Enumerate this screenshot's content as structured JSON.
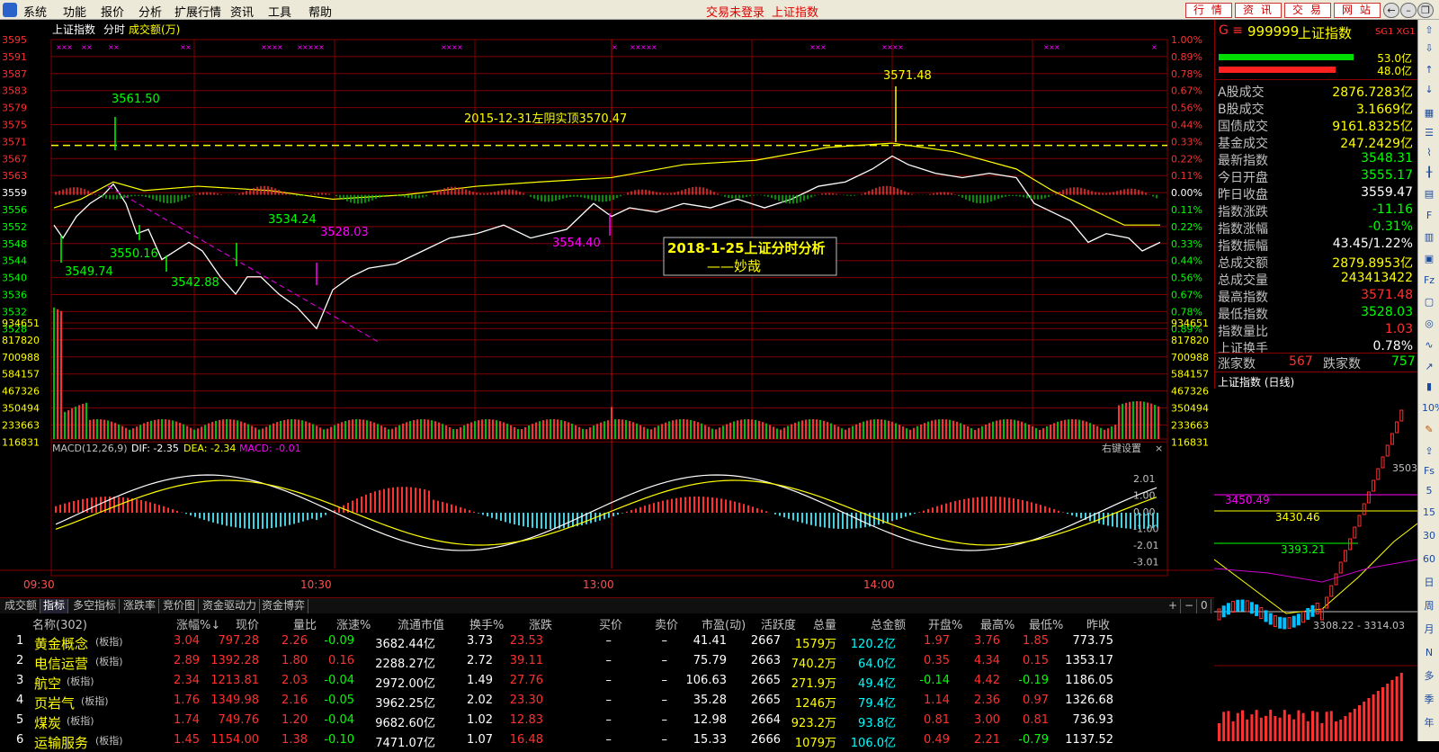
{
  "menu": {
    "items": [
      "系统",
      "功能",
      "报价",
      "分析",
      "扩展行情",
      "资讯",
      "工具",
      "帮助"
    ],
    "status": "交易未登录",
    "index_name": "上证指数",
    "quick_buttons": [
      "行 情",
      "资 讯",
      "交 易",
      "网 站"
    ]
  },
  "chart_header": {
    "name": "上证指数",
    "mode": "分时",
    "vol_label": "成交额(万)"
  },
  "price_axis": {
    "left": [
      "3595",
      "3591",
      "3587",
      "3583",
      "3579",
      "3575",
      "3571",
      "3567",
      "3563",
      "3559",
      "3556",
      "3552",
      "3548",
      "3544",
      "3540",
      "3536",
      "3532",
      "3528"
    ],
    "right": [
      "1.00%",
      "0.89%",
      "0.78%",
      "0.67%",
      "0.56%",
      "0.44%",
      "0.33%",
      "0.22%",
      "0.11%",
      "0.00%",
      "0.11%",
      "0.22%",
      "0.33%",
      "0.44%",
      "0.56%",
      "0.67%",
      "0.78%",
      "0.89%"
    ]
  },
  "volume_axis": [
    "934651",
    "817820",
    "700988",
    "584157",
    "467326",
    "350494",
    "233663",
    "116831"
  ],
  "macd": {
    "title": "MACD(12,26,9)",
    "dif": "DIF: -2.35",
    "dea": "DEA: -2.34",
    "macd": "MACD: -0.01",
    "right_label": "右键设置",
    "axis": [
      "2.01",
      "1.00",
      "0.00",
      "-1.00",
      "-2.01",
      "-3.01"
    ]
  },
  "time_axis": [
    "09:30",
    "10:30",
    "13:00",
    "14:00"
  ],
  "annotations": {
    "p3561": "3561.50",
    "p3549": "3549.74",
    "p3550": "3550.16",
    "p3542": "3542.88",
    "p3534": "3534.24",
    "p3528": "3528.03",
    "p3554": "3554.40",
    "p3571": "3571.48",
    "resist": "2015-12-31左阴实顶3570.47",
    "title1": "2018-1-25上证分时分析",
    "title2": "——妙哉"
  },
  "right_panel": {
    "code_prefix": "G ≡",
    "code": "999999",
    "name": "上证指数",
    "sg": "SG1 XG1",
    "bar1_value": "53.0亿",
    "bar2_value": "48.0亿",
    "rows": [
      {
        "label": "A股成交",
        "value": "2876.7283亿",
        "color": "#ffff00"
      },
      {
        "label": "B股成交",
        "value": "3.1669亿",
        "color": "#ffff00"
      },
      {
        "label": "国债成交",
        "value": "9161.8325亿",
        "color": "#ffff00"
      },
      {
        "label": "基金成交",
        "value": "247.2429亿",
        "color": "#ffff00"
      },
      {
        "label": "最新指数",
        "value": "3548.31",
        "color": "#00ff00"
      },
      {
        "label": "今日开盘",
        "value": "3555.17",
        "color": "#00ff00"
      },
      {
        "label": "昨日收盘",
        "value": "3559.47",
        "color": "#ffffff"
      },
      {
        "label": "指数涨跌",
        "value": "-11.16",
        "color": "#00ff00"
      },
      {
        "label": "指数涨幅",
        "value": "-0.31%",
        "color": "#00ff00"
      },
      {
        "label": "指数振幅",
        "value": "43.45/1.22%",
        "color": "#ffffff"
      },
      {
        "label": "总成交额",
        "value": "2879.8953亿",
        "color": "#ffff00"
      },
      {
        "label": "总成交量",
        "value": "243413422",
        "color": "#ffff00"
      },
      {
        "label": "最高指数",
        "value": "3571.48",
        "color": "#ff3030"
      },
      {
        "label": "最低指数",
        "value": "3528.03",
        "color": "#00ff00"
      },
      {
        "label": "指数量比",
        "value": "1.03",
        "color": "#ff3030"
      },
      {
        "label": "上证换手",
        "value": "0.78%",
        "color": "#ffffff"
      }
    ],
    "up_label": "涨家数",
    "up_value": "567",
    "down_label": "跌家数",
    "down_value": "757",
    "mini_title": "上证指数 (日线)",
    "mini_labels": [
      "3503.",
      "3450.49",
      "3430.46",
      "3393.21",
      "3308.22 - 3314.03"
    ]
  },
  "toolbar_right": [
    "10%",
    "5",
    "15",
    "30",
    "60",
    "日",
    "周",
    "月",
    "N",
    "多",
    "季",
    "年"
  ],
  "tabs": [
    "成交额",
    "指标",
    "多空指标",
    "涨跌率",
    "竞价图",
    "资金驱动力",
    "资金博弈"
  ],
  "tab_controls": [
    "+",
    "−",
    "0"
  ],
  "table": {
    "headers": [
      "名称(302)",
      "涨幅%↓",
      "现价",
      "量比",
      "涨速%",
      "流通市值",
      "换手%",
      "涨跌",
      "买价",
      "卖价",
      "市盈(动)",
      "活跃度",
      "总量",
      "总金额",
      "开盘%",
      "最高%",
      "最低%",
      "昨收"
    ],
    "rows": [
      {
        "idx": "1",
        "name": "黄金概念",
        "tag": "(板指)",
        "chg": "3.04",
        "price": "797.28",
        "vr": "2.26",
        "speed": "-0.09",
        "mcap": "3682.44亿",
        "turn": "3.73",
        "diff": "23.53",
        "bid": "–",
        "ask": "–",
        "pe": "41.41",
        "act": "2667",
        "vol": "1579万",
        "amt": "120.2亿",
        "open": "1.97",
        "high": "3.76",
        "low": "1.85",
        "prev": "773.75"
      },
      {
        "idx": "2",
        "name": "电信运营",
        "tag": "(板指)",
        "chg": "2.89",
        "price": "1392.28",
        "vr": "1.80",
        "speed": "0.16",
        "mcap": "2288.27亿",
        "turn": "2.72",
        "diff": "39.11",
        "bid": "–",
        "ask": "–",
        "pe": "75.79",
        "act": "2663",
        "vol": "740.2万",
        "amt": "64.0亿",
        "open": "0.35",
        "high": "4.34",
        "low": "0.15",
        "prev": "1353.17"
      },
      {
        "idx": "3",
        "name": "航空",
        "tag": "(板指)",
        "chg": "2.34",
        "price": "1213.81",
        "vr": "2.03",
        "speed": "-0.04",
        "mcap": "2972.00亿",
        "turn": "1.49",
        "diff": "27.76",
        "bid": "–",
        "ask": "–",
        "pe": "106.63",
        "act": "2665",
        "vol": "271.9万",
        "amt": "49.4亿",
        "open": "-0.14",
        "high": "4.42",
        "low": "-0.19",
        "prev": "1186.05"
      },
      {
        "idx": "4",
        "name": "页岩气",
        "tag": "(板指)",
        "chg": "1.76",
        "price": "1349.98",
        "vr": "2.16",
        "speed": "-0.05",
        "mcap": "3962.25亿",
        "turn": "2.02",
        "diff": "23.30",
        "bid": "–",
        "ask": "–",
        "pe": "35.28",
        "act": "2665",
        "vol": "1246万",
        "amt": "79.4亿",
        "open": "1.14",
        "high": "2.36",
        "low": "0.97",
        "prev": "1326.68"
      },
      {
        "idx": "5",
        "name": "煤炭",
        "tag": "(板指)",
        "chg": "1.74",
        "price": "749.76",
        "vr": "1.20",
        "speed": "-0.04",
        "mcap": "9682.60亿",
        "turn": "1.02",
        "diff": "12.83",
        "bid": "–",
        "ask": "–",
        "pe": "12.98",
        "act": "2664",
        "vol": "923.2万",
        "amt": "93.8亿",
        "open": "0.81",
        "high": "3.00",
        "low": "0.81",
        "prev": "736.93"
      },
      {
        "idx": "6",
        "name": "运输服务",
        "tag": "(板指)",
        "chg": "1.45",
        "price": "1154.00",
        "vr": "1.38",
        "speed": "-0.10",
        "mcap": "7471.07亿",
        "turn": "1.07",
        "diff": "16.48",
        "bid": "–",
        "ask": "–",
        "pe": "15.33",
        "act": "2666",
        "vol": "1079万",
        "amt": "106.0亿",
        "open": "0.49",
        "high": "2.21",
        "low": "-0.79",
        "prev": "1137.52"
      }
    ]
  },
  "colors": {
    "up": "#ff3030",
    "down": "#00ff00",
    "line": "#ffffff",
    "avg": "#ffff00",
    "grid": "#800000",
    "accent": "#ff00ff"
  }
}
